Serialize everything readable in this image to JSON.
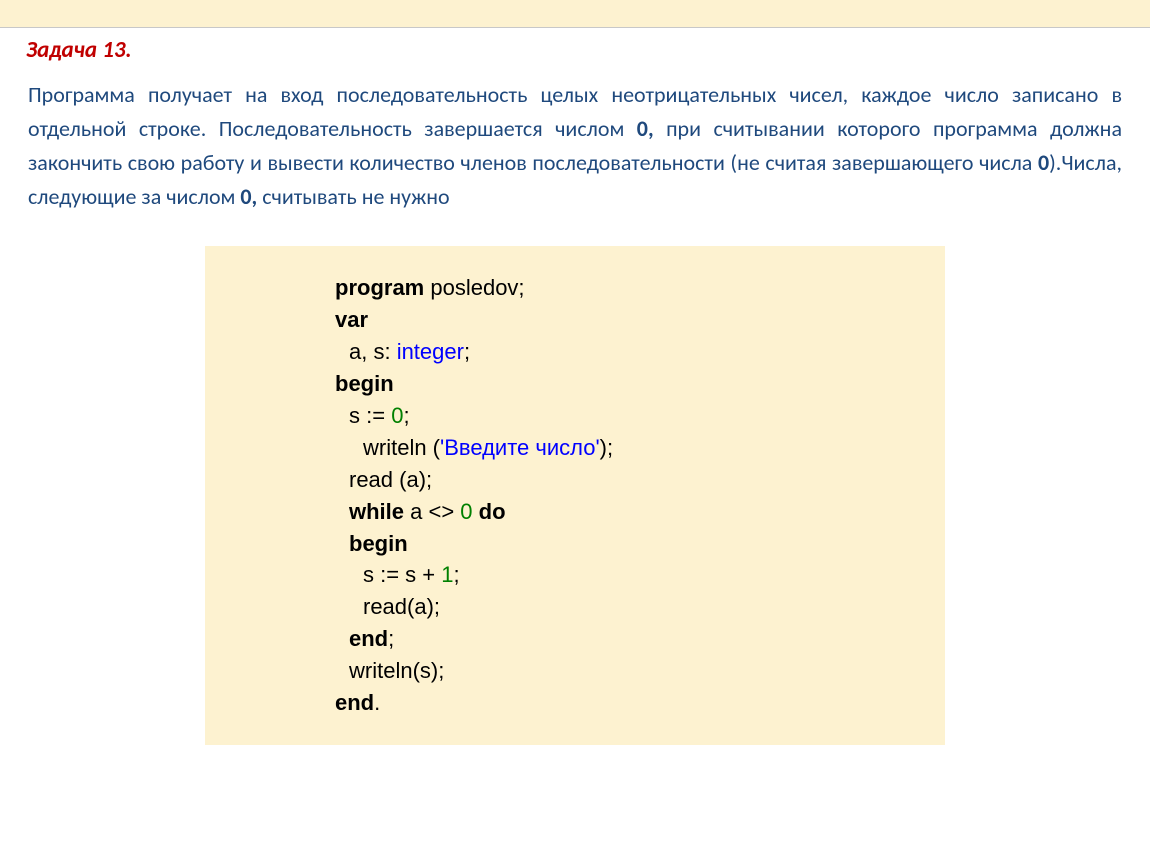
{
  "title": "Задача 13.",
  "problem": {
    "p1": "Программа получает на вход последовательность целых неотрицательных чисел, каждое число записано в отдельной строке. Последовательность завершается числом ",
    "p2": "0, ",
    "p3": "при считывании которого программа должна закончить свою работу и вывести количество членов последовательности (не считая завершающего числа ",
    "p4": "0",
    "p5": ").Числа, следующие за числом ",
    "p6": "0, ",
    "p7": "считывать не нужно"
  },
  "code": {
    "l1a": "program",
    "l1b": " posledov;",
    "l2": "var",
    "l3a": "a, s: ",
    "l3b": "integer",
    "l3c": ";",
    "l4": "begin",
    "l5a": "s := ",
    "l5b": "0",
    "l5c": ";",
    "l6a": "writeln (",
    "l6b": "'Введите число'",
    "l6c": ");",
    "l7": "read (a);",
    "l8a": "while",
    "l8b": " a <> ",
    "l8c": "0",
    "l8d": " ",
    "l8e": "do",
    "l9": "begin",
    "l10a": "s := s + ",
    "l10b": "1",
    "l10c": ";",
    "l11": "read(a);",
    "l12a": "end",
    "l12b": ";",
    "l13": "writeln(s);",
    "l14a": "end",
    "l14b": "."
  }
}
